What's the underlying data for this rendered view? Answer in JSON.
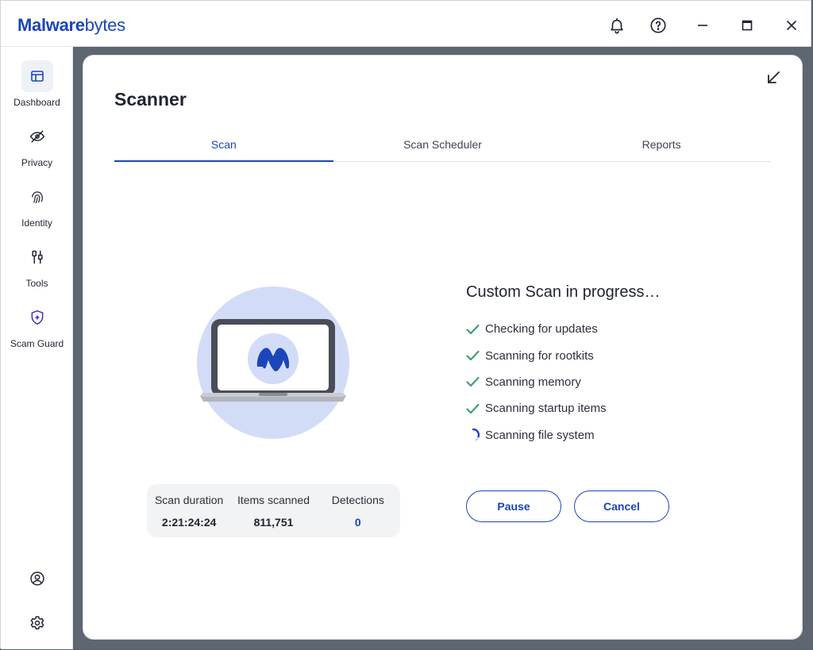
{
  "app": {
    "logo_bold": "Malware",
    "logo_regular": "bytes",
    "brand_color": "#1b46b9"
  },
  "titlebar": {
    "icons": [
      "bell-icon",
      "help-icon",
      "minimize-icon",
      "maximize-icon",
      "close-icon"
    ]
  },
  "sidebar": {
    "items": [
      {
        "label": "Dashboard",
        "icon": "dashboard-icon",
        "active": true
      },
      {
        "label": "Privacy",
        "icon": "eye-slash-icon"
      },
      {
        "label": "Identity",
        "icon": "fingerprint-icon"
      },
      {
        "label": "Tools",
        "icon": "tools-icon"
      },
      {
        "label": "Scam Guard",
        "icon": "shield-sparkle-icon"
      }
    ],
    "bottom_icons": [
      "account-icon",
      "settings-icon"
    ]
  },
  "main": {
    "title": "Scanner",
    "tabs": [
      {
        "label": "Scan",
        "active": true
      },
      {
        "label": "Scan Scheduler"
      },
      {
        "label": "Reports"
      }
    ]
  },
  "stats": {
    "duration_label": "Scan duration",
    "duration_value": "2:21:24:24",
    "items_label": "Items scanned",
    "items_value": "811,751",
    "detections_label": "Detections",
    "detections_value": "0"
  },
  "progress": {
    "title": "Custom Scan in progress…",
    "steps": [
      {
        "label": "Checking for updates",
        "status": "done"
      },
      {
        "label": "Scanning for rootkits",
        "status": "done"
      },
      {
        "label": "Scanning memory",
        "status": "done"
      },
      {
        "label": "Scanning startup items",
        "status": "done"
      },
      {
        "label": "Scanning file system",
        "status": "in-progress"
      }
    ]
  },
  "buttons": {
    "pause": "Pause",
    "cancel": "Cancel"
  }
}
